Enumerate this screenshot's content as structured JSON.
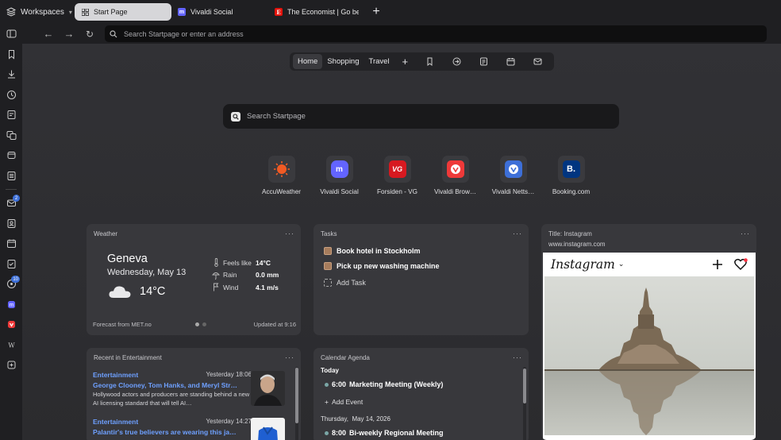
{
  "tabbar": {
    "workspaces_label": "Workspaces",
    "tabs": [
      {
        "label": "Start Page",
        "active": true
      },
      {
        "label": "Vivaldi Social",
        "active": false
      },
      {
        "label": "The Economist | Go beyon",
        "active": false
      }
    ],
    "new_tab": "+"
  },
  "address": {
    "placeholder": "Search Startpage or enter an address"
  },
  "startpage": {
    "nav": [
      {
        "label": "Home",
        "active": true
      },
      {
        "label": "Shopping",
        "active": false
      },
      {
        "label": "Travel",
        "active": false
      }
    ],
    "add": "+",
    "search_placeholder": "Search Startpage"
  },
  "speed_dials": [
    {
      "label": "AccuWeather",
      "icon": "accuweather-icon",
      "color": "#f15a24"
    },
    {
      "label": "Vivaldi Social",
      "icon": "mastodon-icon",
      "color": "#6364ff"
    },
    {
      "label": "Forsiden - VG",
      "icon": "vg-icon",
      "color": "#d71920",
      "text": "VG"
    },
    {
      "label": "Vivaldi Brow…",
      "icon": "vivaldi-icon",
      "color": "#ef3939"
    },
    {
      "label": "Vivaldi Netts…",
      "icon": "vivaldi-icon",
      "color": "#3d6fd8"
    },
    {
      "label": "Booking.com",
      "icon": "booking-icon",
      "color": "#003580",
      "text": "B."
    }
  ],
  "weather": {
    "title": "Weather",
    "city": "Geneva",
    "date": "Wednesday, May 13",
    "temp": "14°C",
    "stats": [
      {
        "key": "Feels like",
        "value": "14°C"
      },
      {
        "key": "Rain",
        "value": "0.0 mm"
      },
      {
        "key": "Wind",
        "value": "4.1 m/s"
      }
    ],
    "source": "Forecast from MET.no",
    "updated": "Updated at 9:16"
  },
  "tasks": {
    "title": "Tasks",
    "items": [
      "Book hotel in Stockholm",
      "Pick up new washing machine"
    ],
    "add_label": "Add Task"
  },
  "instagram": {
    "title": "Title: Instagram",
    "url": "www.instagram.com",
    "logo": "Instagram"
  },
  "entertainment": {
    "title": "Recent in Entertainment",
    "items": [
      {
        "category": "Entertainment",
        "time": "Yesterday 18:06",
        "headline": "George Clooney, Tom Hanks, and Meryl Str…",
        "desc": "Hollywood actors and producers are standing behind a new AI licensing standard that will tell AI…"
      },
      {
        "category": "Entertainment",
        "time": "Yesterday 14:27",
        "headline": "Palantir's true believers are wearing this ja…",
        "desc": ""
      }
    ]
  },
  "calendar": {
    "title": "Calendar Agenda",
    "today_label": "Today",
    "today_events": [
      {
        "time": "6:00",
        "title": "Marketing Meeting (Weekly)"
      }
    ],
    "add_event": "Add Event",
    "next_day_label": "Thursday,",
    "next_day_date": "May 14, 2026",
    "next_events": [
      {
        "time": "8:00",
        "title": "Bi-weekly Regional Meeting"
      }
    ]
  },
  "sidebar": {
    "badges": {
      "mail": "2",
      "feeds": "10"
    }
  }
}
